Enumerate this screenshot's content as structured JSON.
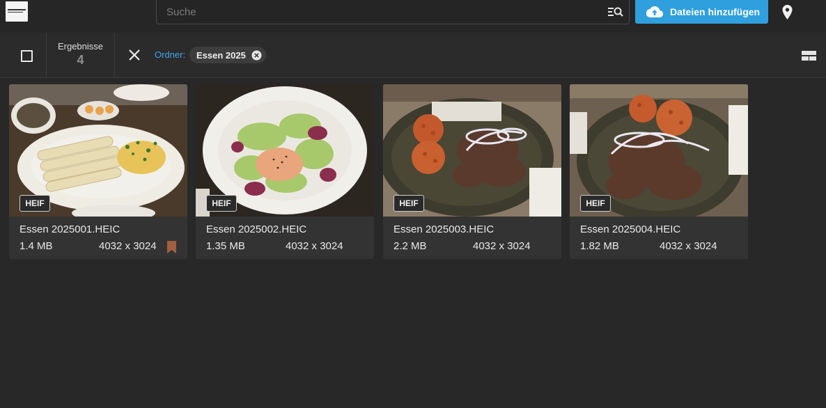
{
  "search": {
    "placeholder": "Suche",
    "value": ""
  },
  "upload": {
    "label": "Dateien hinzufügen"
  },
  "toolbar": {
    "results_label": "Ergebnisse",
    "results_count": "4",
    "folder_label": "Ordner:",
    "folder_chip": "Essen 2025"
  },
  "colors": {
    "accent": "#2f9fdd",
    "link": "#3ea7ec",
    "bookmark": "#a0603f",
    "background": "#282828",
    "card": "#333333"
  },
  "icons": [
    "logo",
    "search-options-icon",
    "cloud-upload-icon",
    "location-pin-icon",
    "checkbox-icon",
    "close-icon",
    "chip-remove-icon",
    "view-toggle-icon",
    "bookmark-icon"
  ],
  "files": [
    {
      "name": "Essen 2025001.HEIC",
      "size": "1.4 MB",
      "dimensions": "4032 x 3024",
      "format": "HEIF",
      "bookmarked": true
    },
    {
      "name": "Essen 2025002.HEIC",
      "size": "1.35 MB",
      "dimensions": "4032 x 3024",
      "format": "HEIF",
      "bookmarked": false
    },
    {
      "name": "Essen 2025003.HEIC",
      "size": "2.2 MB",
      "dimensions": "4032 x 3024",
      "format": "HEIF",
      "bookmarked": false
    },
    {
      "name": "Essen 2025004.HEIC",
      "size": "1.82 MB",
      "dimensions": "4032 x 3024",
      "format": "HEIF",
      "bookmarked": false
    }
  ]
}
